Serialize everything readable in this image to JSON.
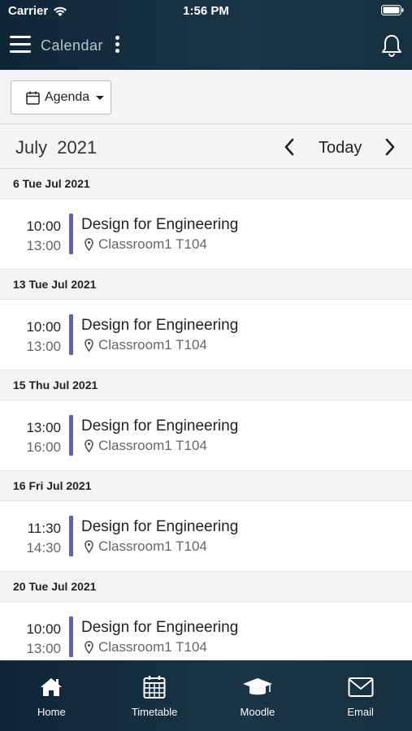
{
  "status_bar": {
    "carrier": "Carrier",
    "time": "1:56 PM"
  },
  "nav": {
    "title": "Calendar"
  },
  "toolbar": {
    "view_label": "Agenda"
  },
  "month_nav": {
    "month_label": "July 2021",
    "today_label": "Today"
  },
  "agenda": {
    "days": [
      {
        "header": "6 Tue Jul 2021",
        "event": {
          "start": "10:00",
          "end": "13:00",
          "title": "Design for Engineering",
          "location": "Classroom1 T104"
        }
      },
      {
        "header": "13 Tue Jul 2021",
        "event": {
          "start": "10:00",
          "end": "13:00",
          "title": "Design for Engineering",
          "location": "Classroom1 T104"
        }
      },
      {
        "header": "15 Thu Jul 2021",
        "event": {
          "start": "13:00",
          "end": "16:00",
          "title": "Design for Engineering",
          "location": "Classroom1 T104"
        }
      },
      {
        "header": "16 Fri Jul 2021",
        "event": {
          "start": "11:30",
          "end": "14:30",
          "title": "Design for Engineering",
          "location": "Classroom1 T104"
        }
      },
      {
        "header": "20 Tue Jul 2021",
        "event": {
          "start": "10:00",
          "end": "13:00",
          "title": "Design for Engineering",
          "location": "Classroom1 T104"
        }
      }
    ],
    "event_bar_color": "#5b63b5"
  },
  "tabs": [
    {
      "label": "Home",
      "icon": "home-icon"
    },
    {
      "label": "Timetable",
      "icon": "calendar-grid-icon"
    },
    {
      "label": "Moodle",
      "icon": "graduation-cap-icon"
    },
    {
      "label": "Email",
      "icon": "envelope-icon"
    }
  ],
  "colors": {
    "header_bg": "#16303f",
    "accent": "#5b63b5"
  }
}
